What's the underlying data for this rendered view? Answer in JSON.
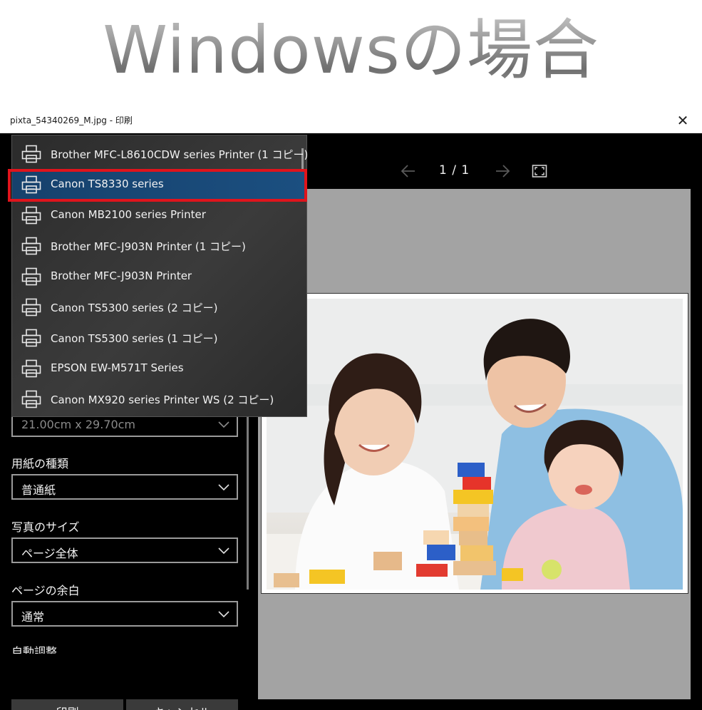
{
  "banner": {
    "title": "Windowsの場合"
  },
  "window": {
    "title": "pixta_54340269_M.jpg - 印刷",
    "close_icon": "close-icon"
  },
  "printer_dropdown": {
    "items": [
      {
        "label": "Brother MFC-L8610CDW series Printer (1 コピー)",
        "icon": "printer-icon",
        "selected": false
      },
      {
        "label": "Canon TS8330 series",
        "icon": "printer-icon",
        "selected": true
      },
      {
        "label": "Canon MB2100 series Printer",
        "icon": "printer-icon",
        "selected": false
      },
      {
        "label": "Brother MFC-J903N Printer (1 コピー)",
        "icon": "printer-icon",
        "selected": false
      },
      {
        "label": "Brother MFC-J903N Printer",
        "icon": "printer-icon",
        "selected": false
      },
      {
        "label": "Canon TS5300 series (2 コピー)",
        "icon": "printer-icon",
        "selected": false
      },
      {
        "label": "Canon TS5300 series (1 コピー)",
        "icon": "printer-icon",
        "selected": false
      },
      {
        "label": "EPSON EW-M571T Series",
        "icon": "printer-icon",
        "selected": false
      },
      {
        "label": "Canon MX920 series Printer WS (2 コピー)",
        "icon": "printer-icon",
        "selected": false
      }
    ],
    "highlight_color": "#e0141c",
    "selected_color": "#1b4f80"
  },
  "settings": {
    "paper_size": {
      "value": "21.00cm x 29.70cm"
    },
    "paper_type": {
      "label": "用紙の種類",
      "value": "普通紙"
    },
    "photo_size": {
      "label": "写真のサイズ",
      "value": "ページ全体"
    },
    "page_margins": {
      "label": "ページの余白",
      "value": "通常"
    },
    "auto_adjust": {
      "label": "自動調整"
    }
  },
  "buttons": {
    "print": "印刷",
    "cancel": "キャンセル"
  },
  "preview": {
    "page_counter": "1 / 1",
    "prev_icon": "arrow-left-icon",
    "next_icon": "arrow-right-icon",
    "fit_icon": "fullscreen-icon"
  }
}
